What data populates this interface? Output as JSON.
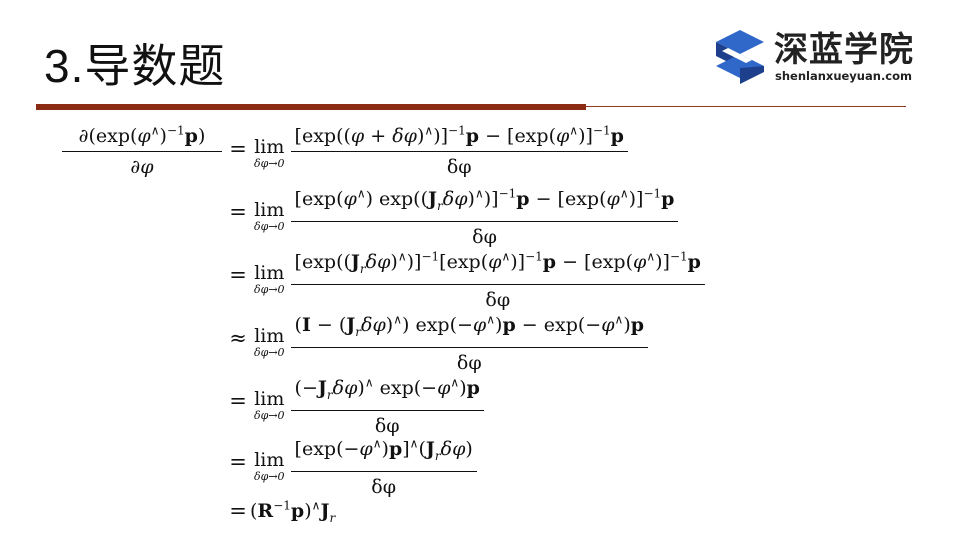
{
  "slide": {
    "title": "3.导数题"
  },
  "logo": {
    "name_cn": "深蓝学院",
    "name_en": "shenlanxueyuan.com",
    "color_dark": "#1d3f8c",
    "color_light": "#2f68c9"
  },
  "colors": {
    "rule": "#8b2b14"
  },
  "math": {
    "lhs_num": "∂(exp(φ^)⁻¹p)",
    "lhs_den": "∂φ",
    "lim_word": "lim",
    "lim_sub": "δφ→0",
    "den": "δφ",
    "rows": [
      {
        "rel": "=",
        "num": "[exp((φ + δφ)^)]⁻¹p − [exp(φ^)]⁻¹p"
      },
      {
        "rel": "=",
        "num": "[exp(φ^) exp((J_r δφ)^)]⁻¹p − [exp(φ^)]⁻¹p"
      },
      {
        "rel": "=",
        "num": "[exp((J_r δφ)^)]⁻¹[exp(φ^)]⁻¹p − [exp(φ^)]⁻¹p"
      },
      {
        "rel": "≈",
        "num": "(I − (J_r δφ)^) exp(−φ^)p − exp(−φ^)p"
      },
      {
        "rel": "=",
        "num": "(−J_r δφ)^ exp(−φ^)p"
      },
      {
        "rel": "=",
        "num": "[exp(−φ^)p]^(J_r δφ)"
      }
    ],
    "final": {
      "rel": "=",
      "expr": "(R⁻¹p)^J_r"
    }
  }
}
